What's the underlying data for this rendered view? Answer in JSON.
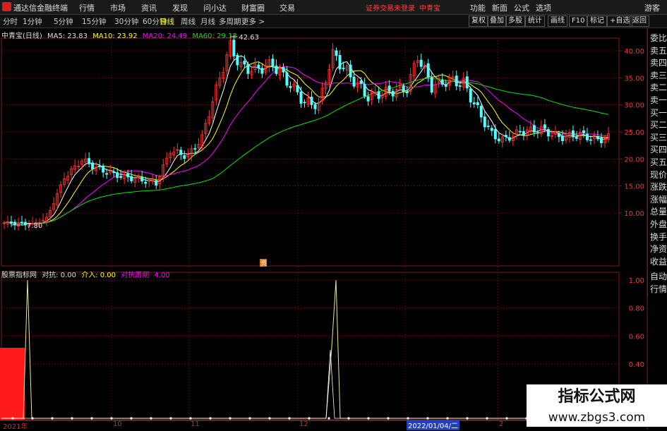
{
  "menubar": {
    "app_name": "通达信金融终端",
    "items": [
      "行情",
      "市场",
      "资讯",
      "发现",
      "问小达",
      "财富圈",
      "交易"
    ],
    "warning": "证券交易未登录",
    "stock": "中青宝",
    "right_items": [
      "功能",
      "新面",
      "公式",
      "选项"
    ],
    "guest": "游客"
  },
  "toolbar": {
    "periods": [
      "分时",
      "1分钟",
      "5分钟",
      "15分钟",
      "30分钟",
      "60分钟",
      "日线",
      "周线",
      "月线",
      "多周期",
      "更多 >"
    ],
    "active": "日线",
    "buttons": [
      "复权",
      "叠加",
      "多股",
      "统计",
      "画线",
      "F10",
      "标记",
      "+自选",
      "返回"
    ]
  },
  "legend": {
    "title": "中青宝(日线)",
    "ma5": "MA5: 23.83",
    "ma10": "MA10: 23.92",
    "ma20": "MA20: 24.49",
    "ma60": "MA60: 29.13"
  },
  "indicator": {
    "name": "股票指标网",
    "duikang": "对抗: 0.00",
    "jieru": "介入: 0.00",
    "period": "对抗周期",
    "period_val": "4.00"
  },
  "orderbook": [
    "委比",
    "卖五",
    "卖四",
    "卖三",
    "卖二",
    "卖一",
    "买一",
    "买二",
    "买三",
    "买四",
    "买五",
    "现价",
    "涨跌",
    "涨幅",
    "总量",
    "外盘",
    "换手",
    "净资",
    "收益"
  ],
  "orderbook2": [
    "自动",
    "行情"
  ],
  "annotations": {
    "high": "42.63",
    "low": "7.80",
    "tag": "资"
  },
  "price_axis": [
    "40.00",
    "35.00",
    "30.00",
    "25.00",
    "20.00",
    "15.00",
    "10.00"
  ],
  "ind_axis": [
    "1.00",
    "0.80",
    "0.60",
    "0.40"
  ],
  "dates": {
    "start": "2021年",
    "m10": "10",
    "m11": "11",
    "m12": "12",
    "selected": "2022/01/04/二",
    "m2": "2"
  },
  "watermark": {
    "title": "指标公式网",
    "url": "www.zbgs3.com"
  },
  "colors": {
    "up": "#ff3232",
    "down": "#54ffff",
    "ma5": "#ffffff",
    "ma10": "#ffff00",
    "ma20": "#ff00ff",
    "ma60": "#00e600",
    "grid": "#7a1c1c"
  }
}
